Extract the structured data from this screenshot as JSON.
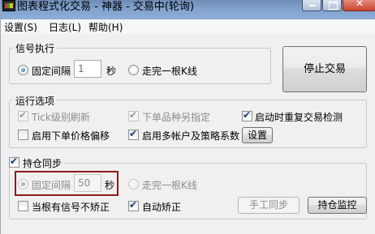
{
  "window": {
    "title": "图表程式化交易 - 神器 - 交易中(轮询)"
  },
  "menu": {
    "items": [
      "设置(S)",
      "日志(L)",
      "帮助(H)"
    ]
  },
  "signal": {
    "group_title": "信号执行",
    "fixed_interval_label": "固定间隔",
    "interval_value": "1",
    "unit": "秒",
    "bar_close_label": "走完一根K线",
    "stop_button": "停止交易"
  },
  "options": {
    "group_title": "运行选项",
    "tick_refresh": "Tick级别刷新",
    "product_mapping": "下单品种另指定",
    "repeat_check": "启动时重复交易检测",
    "price_offset": "启用下单价格偏移",
    "multi_account": "启用多帐户及策略系数",
    "settings_button": "设置"
  },
  "position": {
    "group_title": "持仓同步",
    "fixed_interval_label": "固定间隔",
    "interval_value": "50",
    "unit": "秒",
    "bar_close_label": "走完一根K线",
    "no_correct_on_signal": "当根有信号不矫正",
    "auto_correct": "自动矫正",
    "manual_sync_button": "手工同步",
    "monitor_button": "持仓监控"
  }
}
